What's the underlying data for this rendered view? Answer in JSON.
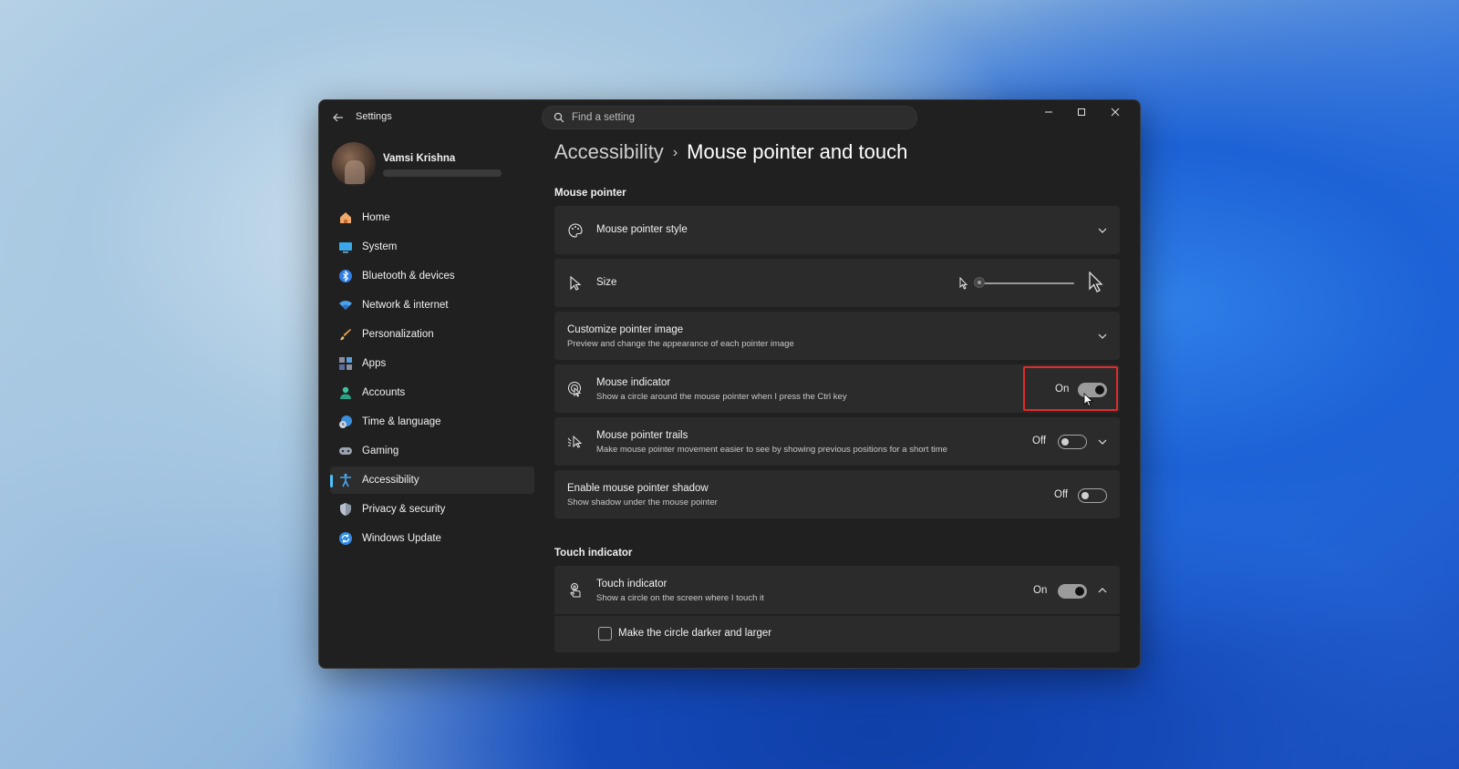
{
  "window": {
    "app_title": "Settings",
    "search_placeholder": "Find a setting"
  },
  "profile": {
    "name": "Vamsi Krishna"
  },
  "sidebar": {
    "items": [
      {
        "label": "Home",
        "icon": "home-icon"
      },
      {
        "label": "System",
        "icon": "system-icon"
      },
      {
        "label": "Bluetooth & devices",
        "icon": "bluetooth-icon"
      },
      {
        "label": "Network & internet",
        "icon": "wifi-icon"
      },
      {
        "label": "Personalization",
        "icon": "brush-icon"
      },
      {
        "label": "Apps",
        "icon": "apps-icon"
      },
      {
        "label": "Accounts",
        "icon": "person-icon"
      },
      {
        "label": "Time & language",
        "icon": "clock-globe-icon"
      },
      {
        "label": "Gaming",
        "icon": "gamepad-icon"
      },
      {
        "label": "Accessibility",
        "icon": "accessibility-icon",
        "active": true
      },
      {
        "label": "Privacy & security",
        "icon": "shield-icon"
      },
      {
        "label": "Windows Update",
        "icon": "update-icon"
      }
    ]
  },
  "breadcrumb": {
    "parent": "Accessibility",
    "separator": "›",
    "current": "Mouse pointer and touch"
  },
  "sections": {
    "mouse_pointer": "Mouse pointer",
    "touch_indicator": "Touch indicator"
  },
  "settings": {
    "pointer_style": {
      "title": "Mouse pointer style"
    },
    "size": {
      "title": "Size",
      "value": 0.0
    },
    "customize": {
      "title": "Customize pointer image",
      "desc": "Preview and change the appearance of each pointer image"
    },
    "mouse_indicator": {
      "title": "Mouse indicator",
      "desc": "Show a circle around the mouse pointer when I press the Ctrl key",
      "state": "On"
    },
    "pointer_trails": {
      "title": "Mouse pointer trails",
      "desc": "Make mouse pointer movement easier to see by showing previous positions for a short time",
      "state": "Off"
    },
    "pointer_shadow": {
      "title": "Enable mouse pointer shadow",
      "desc": "Show shadow under the mouse pointer",
      "state": "Off"
    },
    "touch_indicator": {
      "title": "Touch indicator",
      "desc": "Show a circle on the screen where I touch it",
      "state": "On"
    },
    "darker_circle": {
      "label": "Make the circle darker and larger",
      "checked": false
    }
  },
  "colors": {
    "accent": "#4cc2ff",
    "highlight_box": "#e02b2b",
    "window_bg": "#202020",
    "card_bg": "#2b2b2b"
  }
}
